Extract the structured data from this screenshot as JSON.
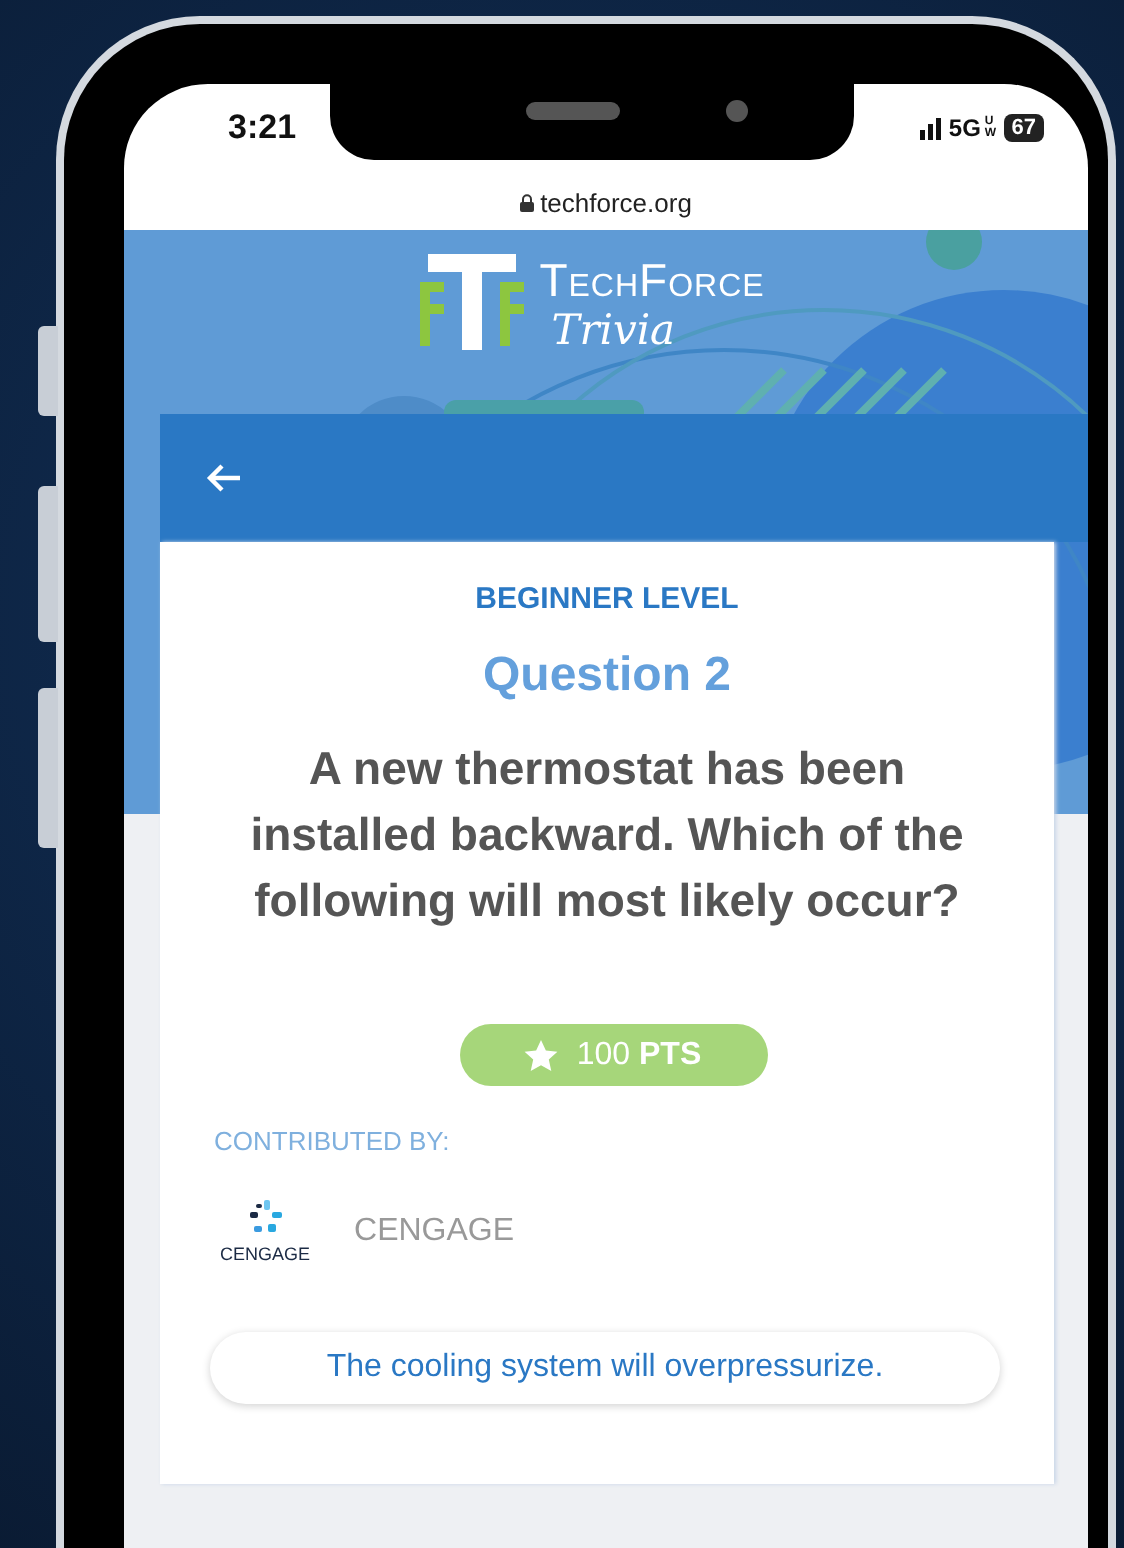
{
  "status_bar": {
    "time": "3:21",
    "network": "5G",
    "network_badge": "UW",
    "battery": "67"
  },
  "browser": {
    "url": "techforce.org"
  },
  "app": {
    "logo_title": "TechForce",
    "logo_subtitle": "Trivia"
  },
  "question": {
    "level": "BEGINNER LEVEL",
    "number": "Question 2",
    "text": "A new thermostat has been installed backward. Which of the following will most likely occur?",
    "points": "100 **PTS**",
    "contributed_label": "CONTRIBUTED BY:",
    "contributor_logo_text": "CENGAGE",
    "contributor": "CENGAGE"
  },
  "answers": [
    {
      "text": "The cooling system will overpressurize.",
      "selected": false
    }
  ]
}
